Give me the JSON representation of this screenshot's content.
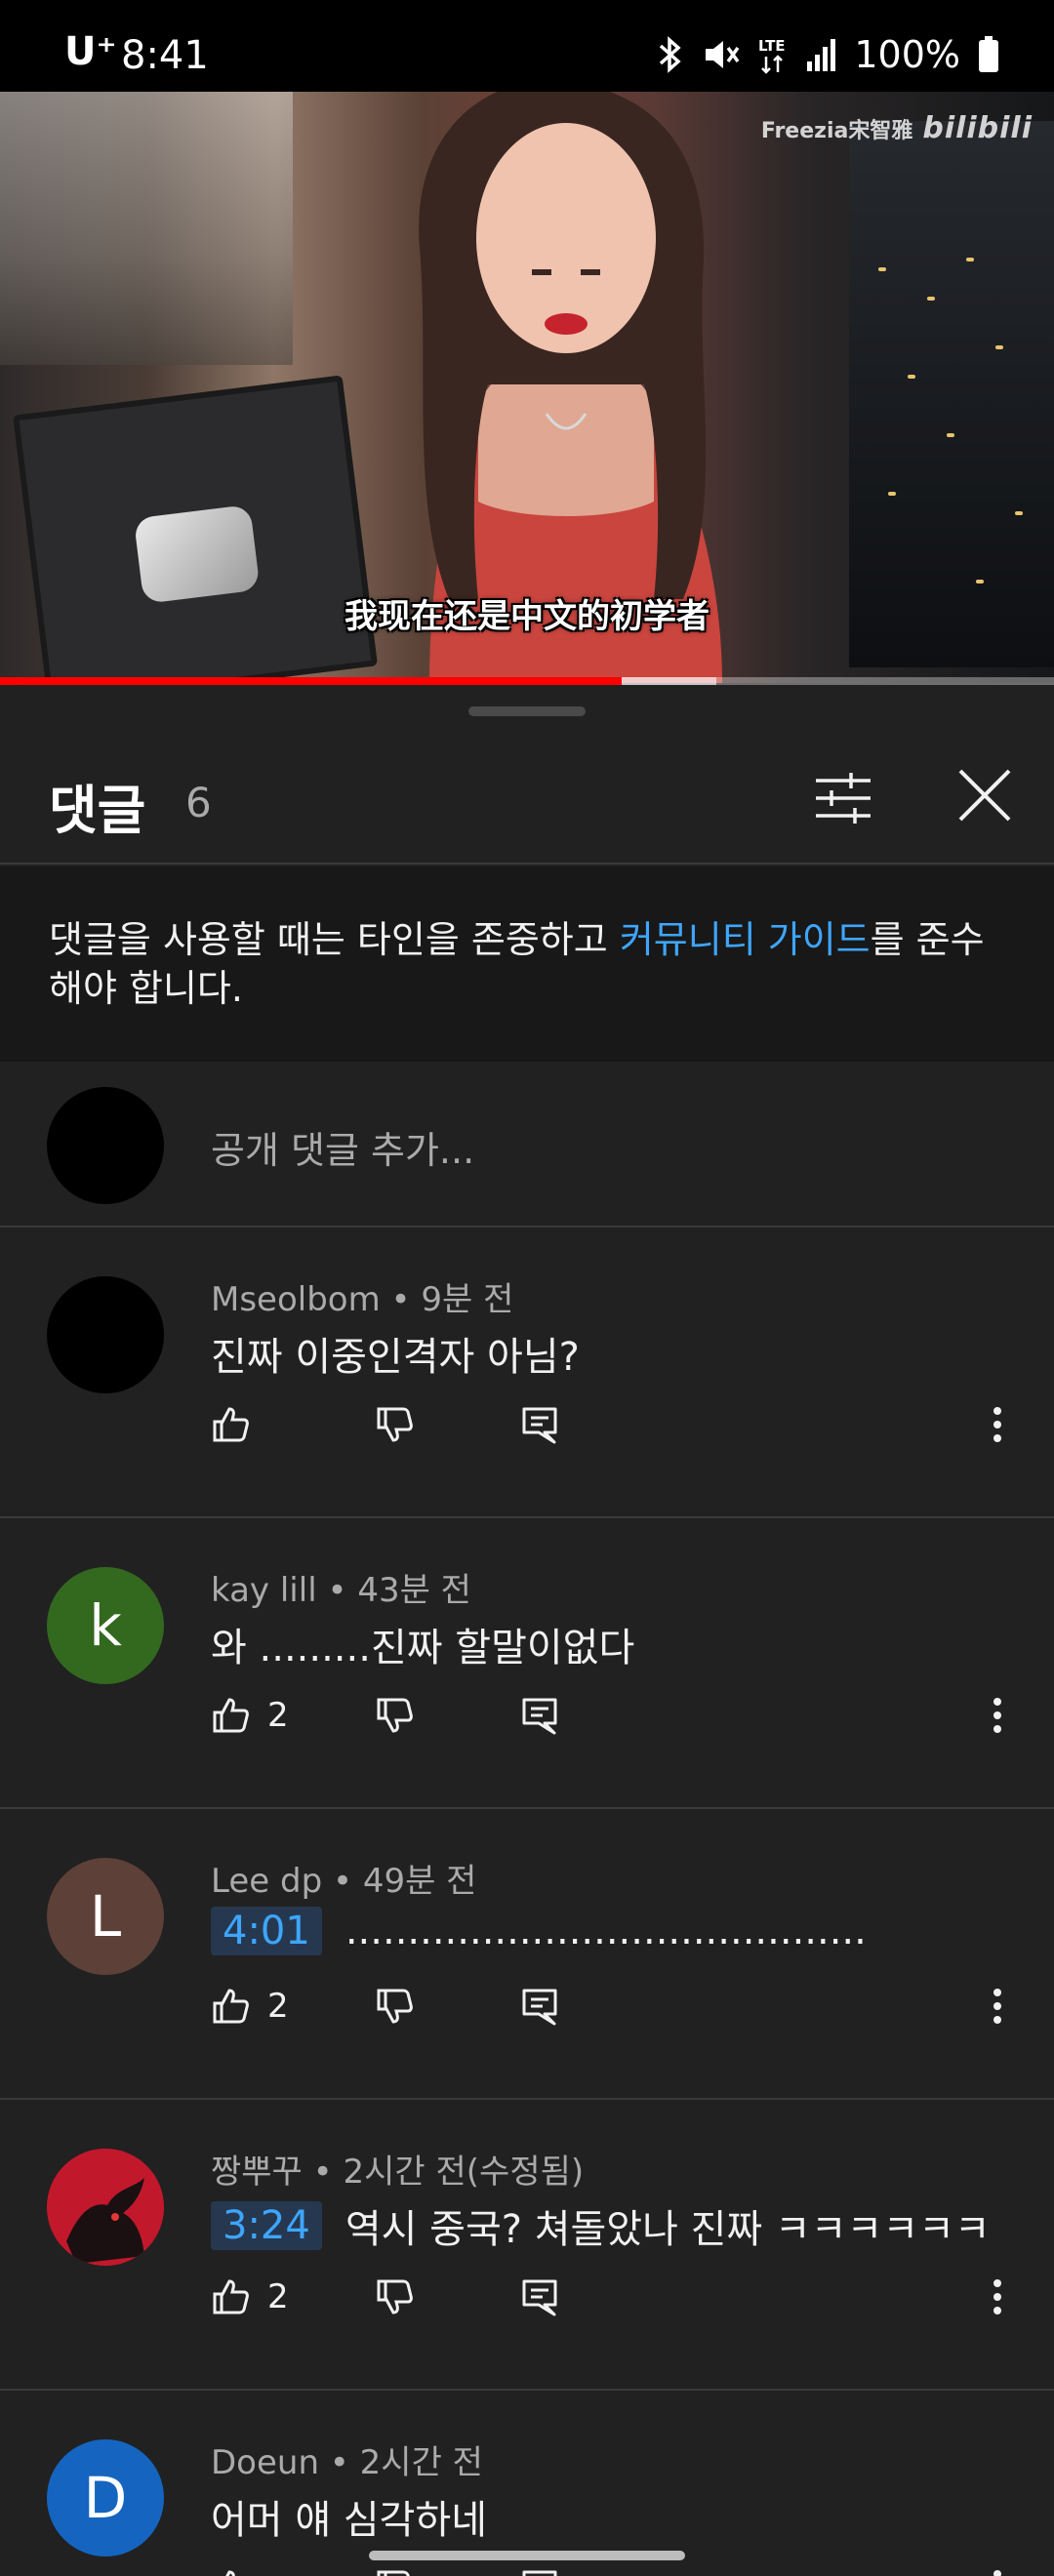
{
  "status_bar": {
    "carrier": "U⁺",
    "time": "8:41",
    "network": "LTE",
    "battery": "100%"
  },
  "video": {
    "watermark_channel": "Freezia宋智雅",
    "watermark_brand": "bilibili",
    "subtitle": "我现在还是中文的初学者",
    "progress_played": 0.59,
    "progress_buffered": 0.68
  },
  "comments_panel": {
    "title": "댓글",
    "count": "6",
    "guideline_prefix": "댓글을 사용할 때는 타인을 존중하고 ",
    "guideline_link": "커뮤니티 가이드",
    "guideline_suffix": "를 준수해야 합니다.",
    "add_placeholder": "공개 댓글 추가...",
    "comments": [
      {
        "author": "Mseolbom",
        "time": "9분 전",
        "timestamp": "",
        "text": "진짜 이중인격자 아님?",
        "likes": "",
        "avatar_letter": "",
        "avatar_color": "#000000"
      },
      {
        "author": "kay lill",
        "time": "43분 전",
        "timestamp": "",
        "text": "와 .........진짜 할말이없다",
        "likes": "2",
        "avatar_letter": "k",
        "avatar_color": "#33691e"
      },
      {
        "author": "Lee dp",
        "time": "49분 전",
        "timestamp": "4:01",
        "text": "..........................................",
        "likes": "2",
        "avatar_letter": "L",
        "avatar_color": "#5d4037"
      },
      {
        "author": "짱뿌꾸",
        "time": "2시간 전(수정됨)",
        "timestamp": "3:24",
        "text": "역시 중국? 쳐돌았나 진짜 ㅋㅋㅋㅋㅋㅋ",
        "likes": "2",
        "avatar_letter": "",
        "avatar_color": "#c2182b"
      },
      {
        "author": "Doeun",
        "time": "2시간 전",
        "timestamp": "",
        "text": "어머 얘 심각하네",
        "likes": "",
        "avatar_letter": "D",
        "avatar_color": "#1565c0"
      }
    ]
  },
  "colors": {
    "background": "#212121",
    "link": "#3ea6ff",
    "progress": "#ff0000",
    "secondary_text": "#aaaaaa"
  }
}
